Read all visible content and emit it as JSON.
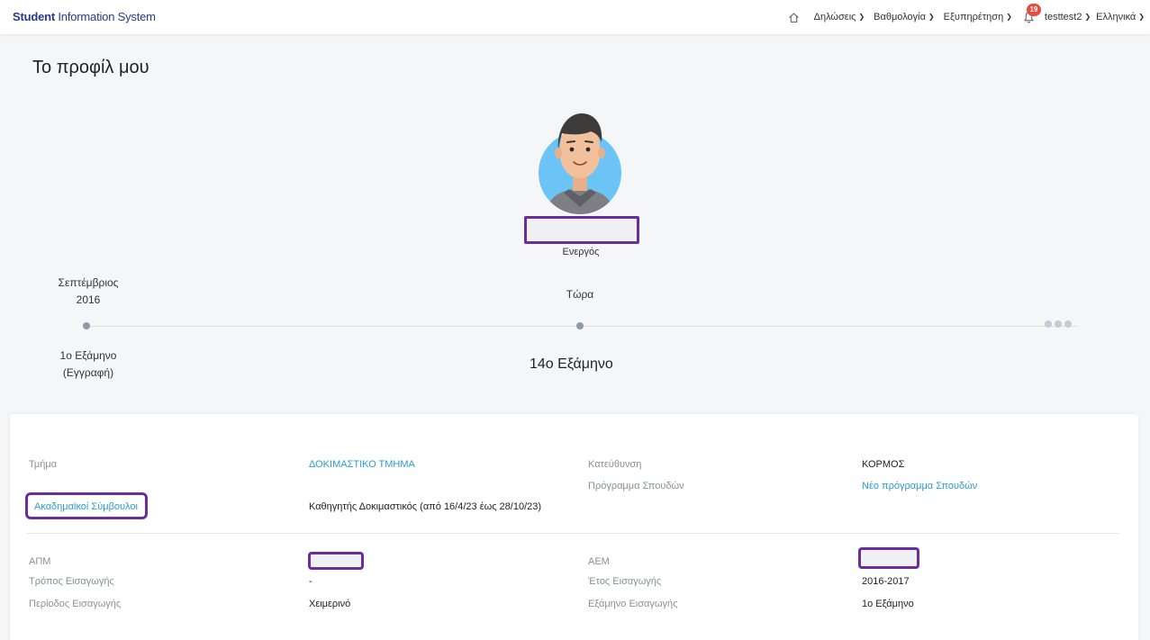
{
  "navbar": {
    "brand_bold": "Student",
    "brand_rest": " Information System",
    "menu": [
      {
        "label": "Δηλώσεις"
      },
      {
        "label": "Βαθμολογία"
      },
      {
        "label": "Εξυπηρέτηση"
      }
    ],
    "notification_count": "19",
    "user": "testtest2",
    "language": "Ελληνικά"
  },
  "page": {
    "title": "Το προφίλ μου"
  },
  "profile": {
    "status": "Ενεργός"
  },
  "timeline": {
    "start_month": "Σεπτέμβριος",
    "start_year": "2016",
    "start_semester": "1ο Εξάμηνο",
    "start_note": "(Εγγραφή)",
    "now_label": "Τώρα",
    "now_semester": "14ο Εξάμηνο"
  },
  "info": {
    "department_label": "Τμήμα",
    "department_value": "ΔΟΚΙΜΑΣΤΙΚΟ ΤΜΗΜΑ",
    "direction_label": "Κατεύθυνση",
    "direction_value": "ΚΟΡΜΟΣ",
    "program_label": "Πρόγραμμα Σπουδών",
    "program_value": "Νέο πρόγραμμα Σπουδών",
    "advisors_label": "Ακαδημαϊκοί Σύμβουλοι",
    "advisors_value": "Καθηγητής Δοκιμαστικός (από 16/4/23 έως 28/10/23)",
    "apm_label": "ΑΠΜ",
    "aem_label": "ΑΕΜ",
    "entry_method_label": "Τρόπος Εισαγωγής",
    "entry_method_value": "-",
    "entry_year_label": "Έτος Εισαγωγής",
    "entry_year_value": "2016-2017",
    "entry_period_label": "Περίοδος Εισαγωγής",
    "entry_period_value": "Χειμερινό",
    "entry_semester_label": "Εξάμηνο Εισαγωγής",
    "entry_semester_value": "1ο Εξάμηνο"
  },
  "colors": {
    "brand": "#2a3a8a",
    "highlight": "#6a2e9c",
    "link": "#2b9bd8",
    "badge": "#e74c3c"
  }
}
